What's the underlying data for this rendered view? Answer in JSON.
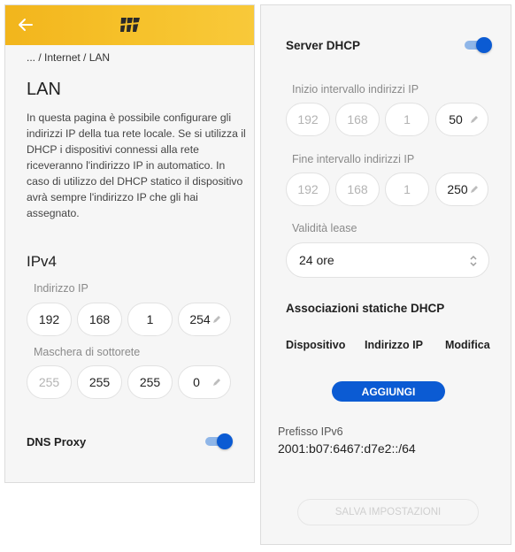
{
  "left": {
    "breadcrumb": "... / Internet / LAN",
    "title": "LAN",
    "description": "In questa pagina è possibile configurare gli indirizzi IP della tua rete locale. Se si utilizza il DHCP i dispositivi connessi alla rete riceveranno l'indirizzo IP in automatico. In caso di utilizzo del DHCP statico il dispositivo avrà sempre l'indirizzo IP che gli hai assegnato.",
    "ipv4_title": "IPv4",
    "ip_label": "Indirizzo IP",
    "ip": [
      "192",
      "168",
      "1",
      "254"
    ],
    "mask_label": "Maschera di sottorete",
    "mask": [
      "255",
      "255",
      "255",
      "0"
    ],
    "dns_proxy_label": "DNS Proxy",
    "dns_proxy_on": true
  },
  "right": {
    "dhcp_label": "Server DHCP",
    "dhcp_on": true,
    "start_label": "Inizio intervallo indirizzi IP",
    "start": [
      "192",
      "168",
      "1",
      "50"
    ],
    "end_label": "Fine intervallo indirizzi IP",
    "end": [
      "192",
      "168",
      "1",
      "250"
    ],
    "lease_label": "Validità lease",
    "lease_value": "24 ore",
    "static_title": "Associazioni statiche DHCP",
    "col_device": "Dispositivo",
    "col_ip": "Indirizzo IP",
    "col_edit": "Modifica",
    "add_button": "AGGIUNGI",
    "ipv6_label": "Prefisso IPv6",
    "ipv6_value": "2001:b07:6467:d7e2::/64",
    "save_button": "SALVA IMPOSTAZIONI"
  },
  "colors": {
    "accent": "#0b5bd3",
    "header": "#f6c12a",
    "toggle_track": "#8fb6e8"
  },
  "icons": {
    "back": "arrow-left-icon",
    "logo": "brand-logo-icon",
    "edit": "pencil-icon",
    "chevron": "chevron-up-down-icon"
  }
}
